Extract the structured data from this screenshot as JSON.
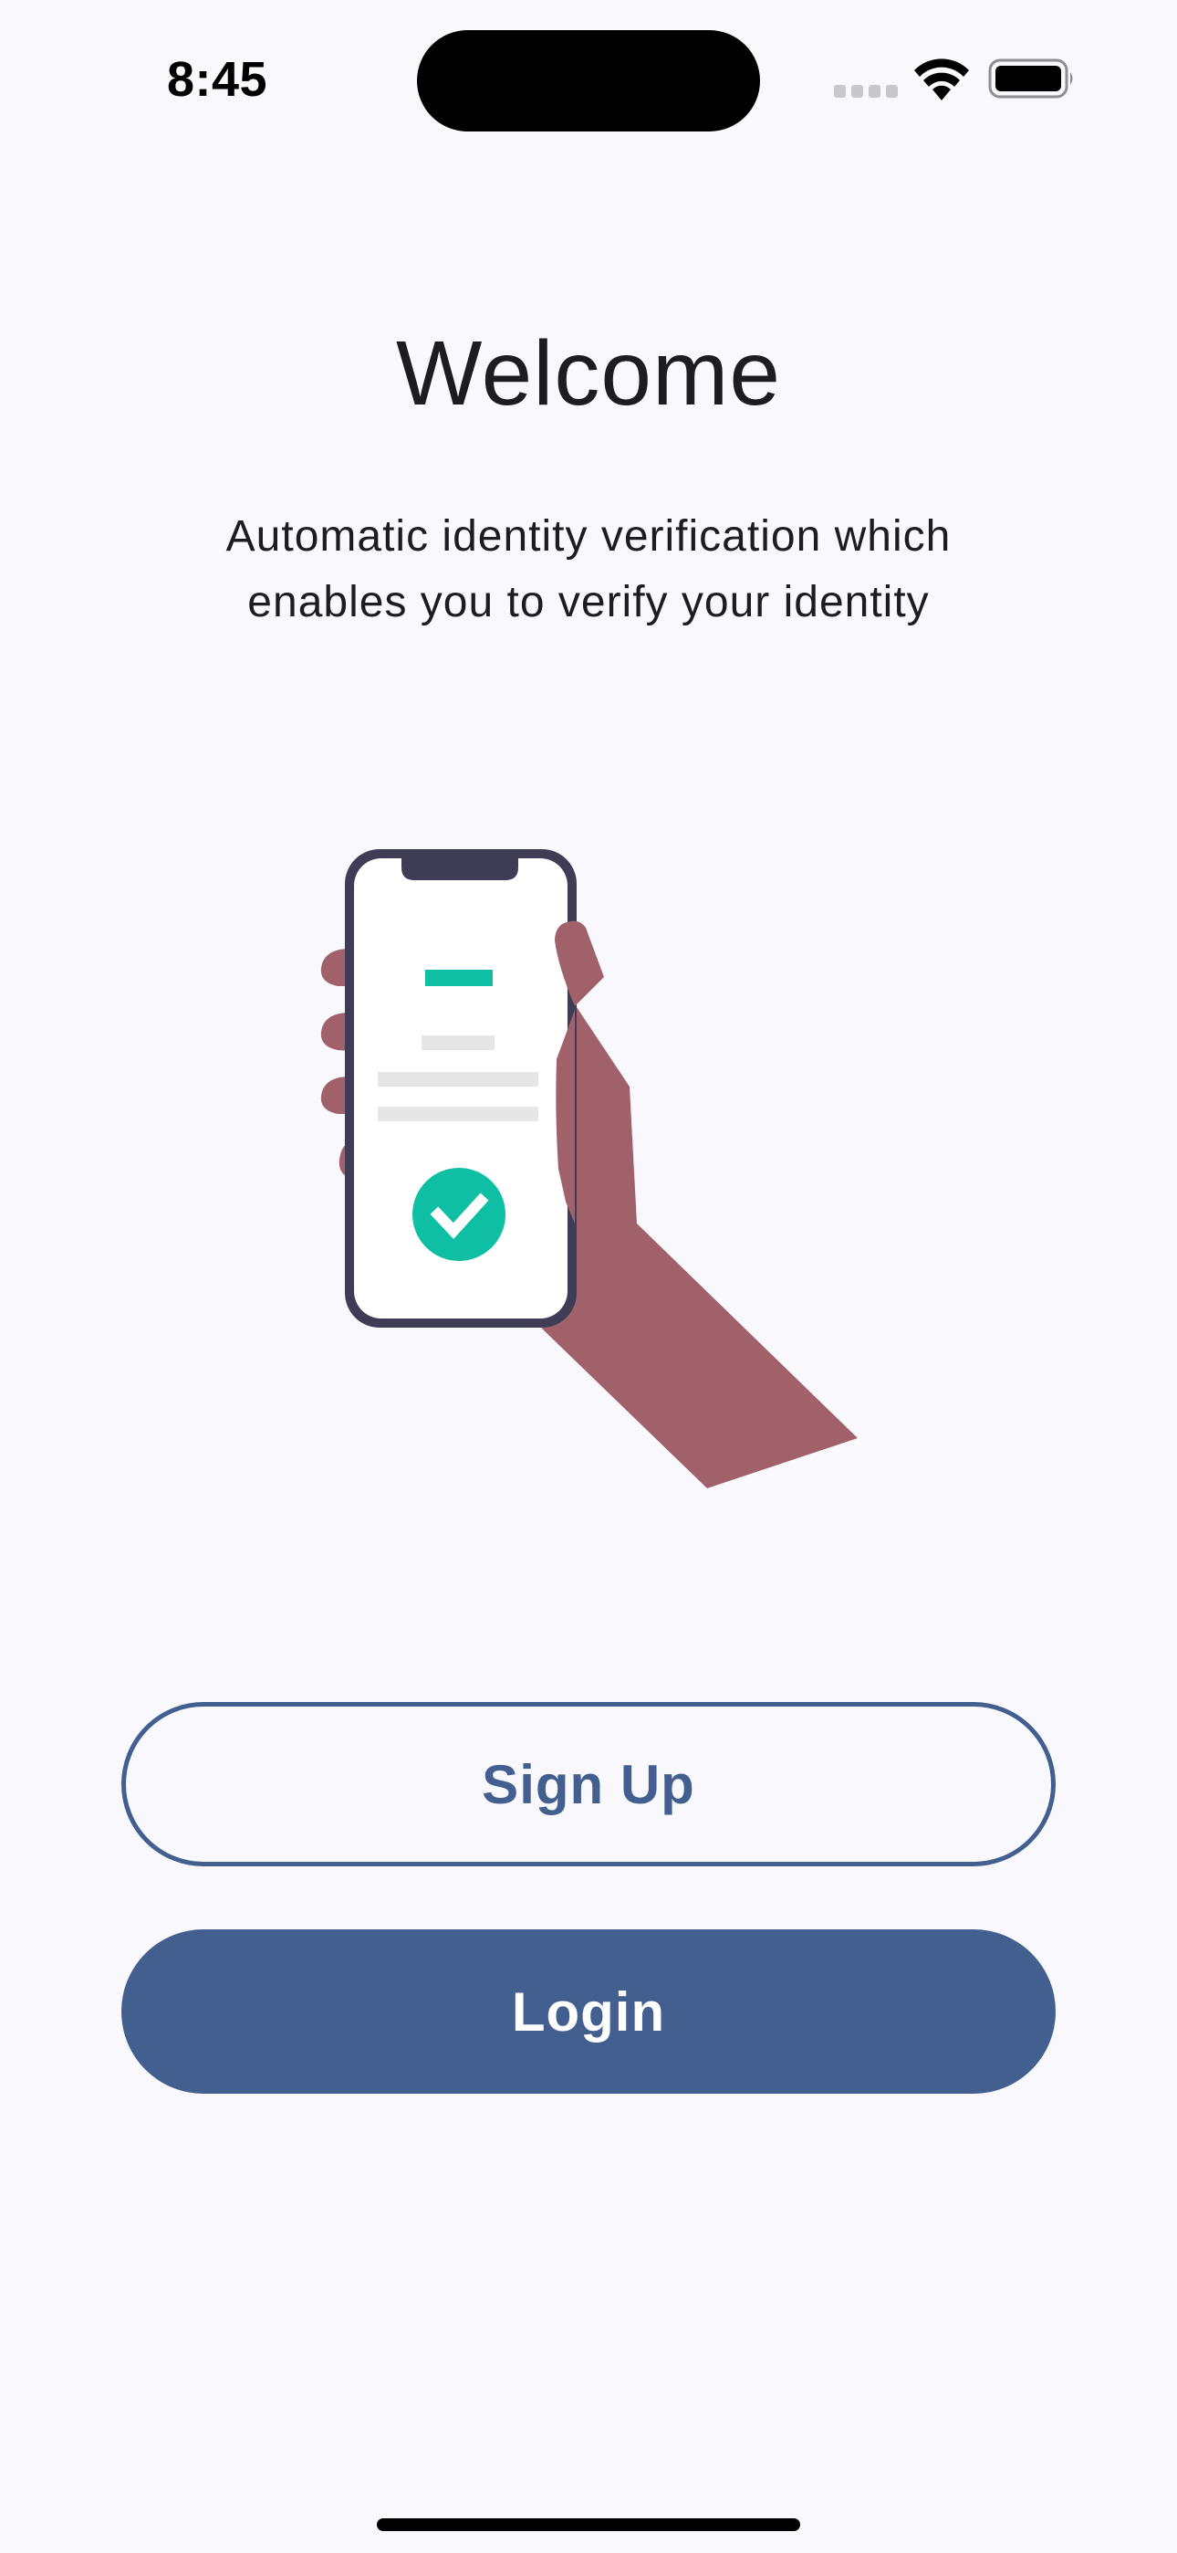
{
  "status_bar": {
    "time": "8:45",
    "icons": [
      "cellular-signal-icon",
      "wifi-icon",
      "battery-icon"
    ]
  },
  "welcome": {
    "title": "Welcome",
    "subtitle": "Automatic identity verification which enables you to verify your identity"
  },
  "illustration": {
    "icon": "hand-holding-phone-verified-illustration",
    "check_icon": "checkmark-icon"
  },
  "buttons": {
    "signup_label": "Sign Up",
    "login_label": "Login"
  },
  "colors": {
    "background": "#f8f8fd",
    "primary": "#435f90",
    "accent": "#0fbfa4",
    "skin": "#a0616a",
    "phone_frame": "#3f3d56"
  }
}
